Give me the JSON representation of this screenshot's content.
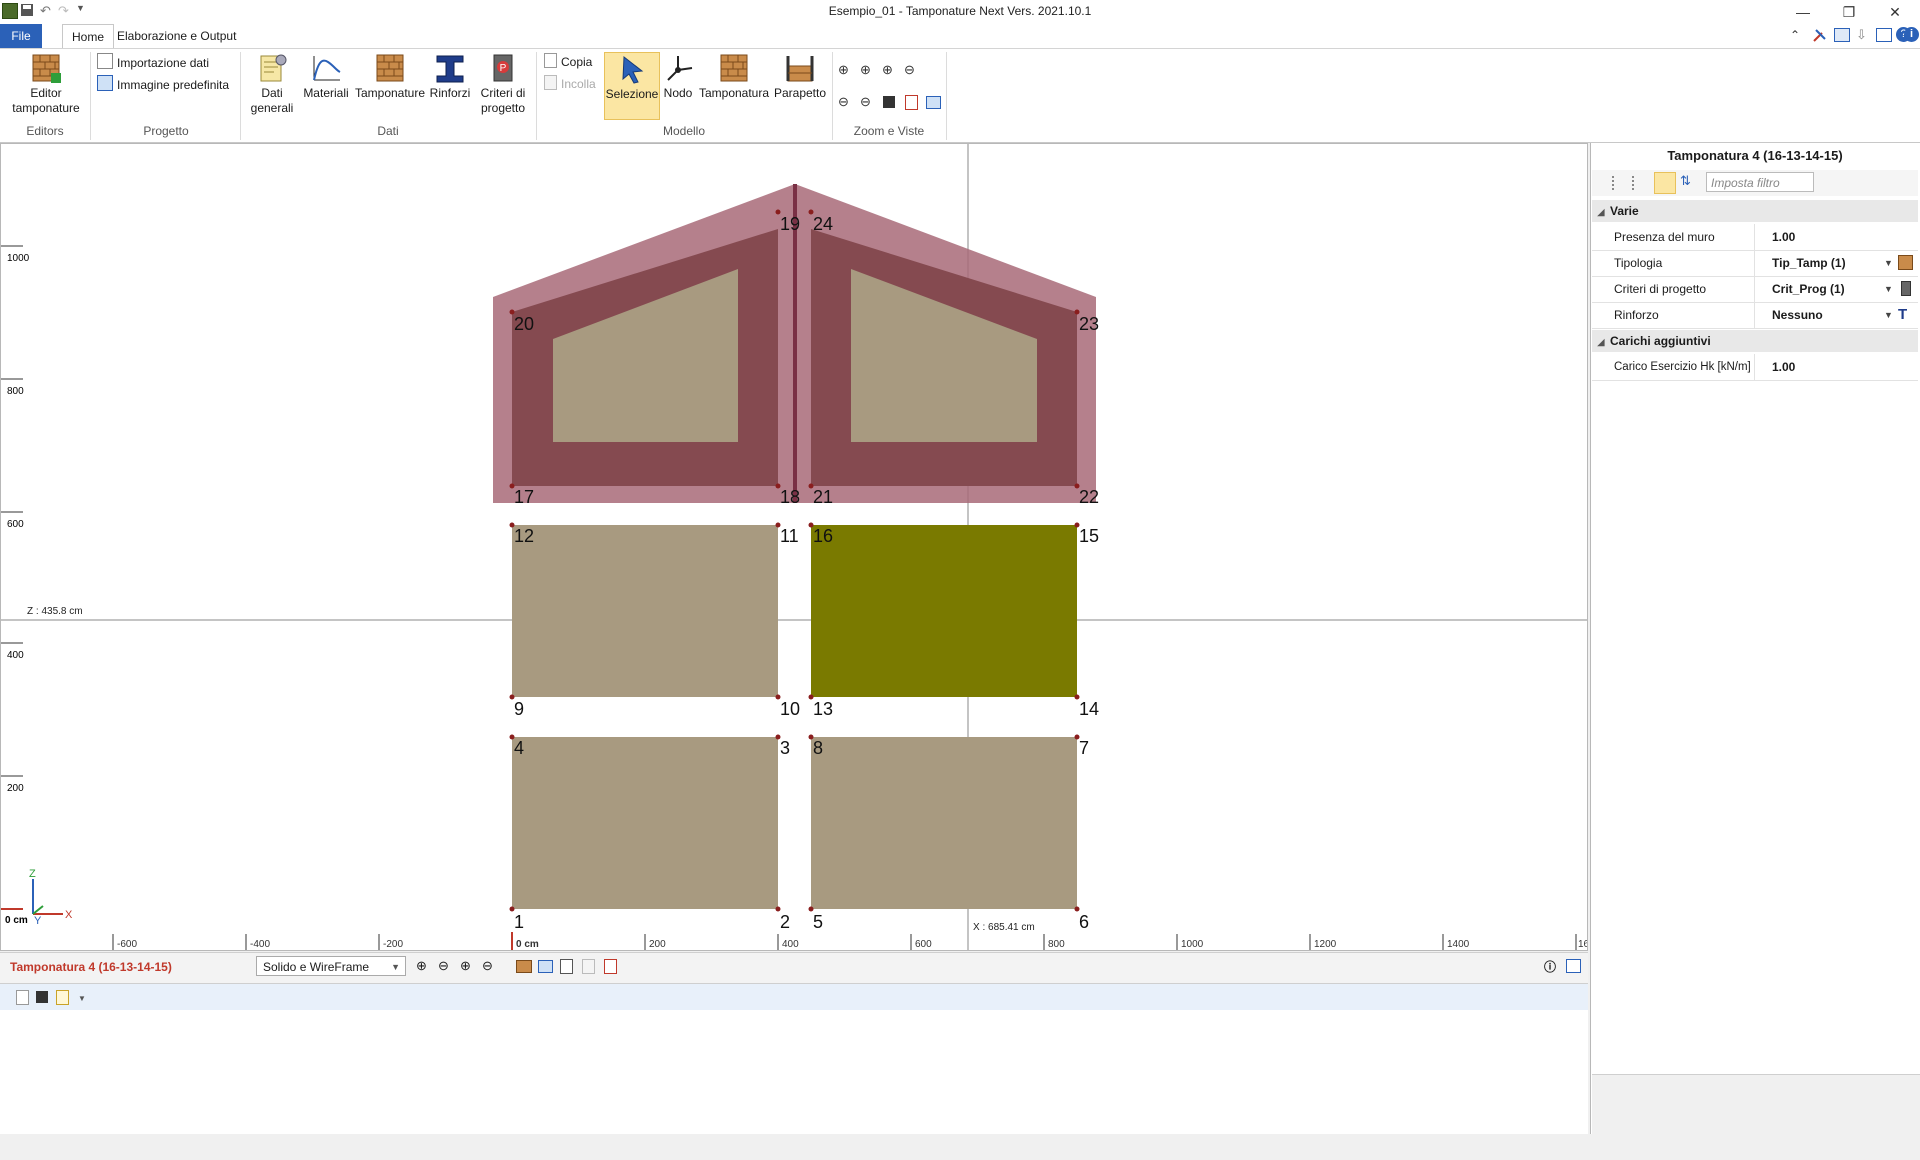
{
  "window": {
    "title": "Esempio_01 - Tamponature Next Vers. 2021.10.1",
    "minimize": "—",
    "restore": "❐",
    "close": "✕"
  },
  "tabs": {
    "file": "File",
    "home": "Home",
    "elab": "Elaborazione e Output"
  },
  "ribbon": {
    "editor": "Editor tamponature",
    "import": "Importazione dati",
    "image": "Immagine predefinita",
    "dati_generali": "Dati generali",
    "materiali": "Materiali",
    "tamponature": "Tamponature",
    "rinforzi": "Rinforzi",
    "criteri": "Criteri di progetto",
    "copia": "Copia",
    "incolla": "Incolla",
    "selezione": "Selezione",
    "nodo": "Nodo",
    "tamponatura": "Tamponatura",
    "parapetto": "Parapetto",
    "groups": {
      "editors": "Editors",
      "progetto": "Progetto",
      "dati": "Dati",
      "modello": "Modello",
      "zoom": "Zoom e Viste"
    }
  },
  "viewport": {
    "z_readout": "Z : 435.8 cm",
    "x_readout": "X : 685.41 cm",
    "y_ticks": [
      "1000",
      "800",
      "600",
      "400",
      "200"
    ],
    "y_origin": "0 cm",
    "x_ticks": [
      "-600",
      "-400",
      "-200",
      "0 cm",
      "200",
      "400",
      "600",
      "800",
      "1000",
      "1200",
      "1400",
      "16"
    ],
    "axis_z": "Z",
    "axis_x": "X",
    "axis_y": "Y",
    "nodes": [
      "1",
      "2",
      "3",
      "4",
      "5",
      "6",
      "7",
      "8",
      "9",
      "10",
      "11",
      "12",
      "13",
      "14",
      "15",
      "16",
      "17",
      "18",
      "19",
      "20",
      "21",
      "22",
      "23",
      "24"
    ]
  },
  "colors": {
    "wall": "#a89a80",
    "selected": "#7a7a00",
    "gable_outer": "#a86a78",
    "gable_inner": "#854a50",
    "accent": "#2b61b8"
  },
  "bottom": {
    "selection": "Tamponatura 4 (16-13-14-15)",
    "render_mode": "Solido e WireFrame"
  },
  "panel": {
    "title": "Tamponatura 4 (16-13-14-15)",
    "filter_placeholder": "Imposta filtro",
    "categories": [
      {
        "name": "Varie",
        "rows": [
          {
            "label": "Presenza del muro",
            "value": "1.00"
          },
          {
            "label": "Tipologia",
            "value": "Tip_Tamp (1)"
          },
          {
            "label": "Criteri di progetto",
            "value": "Crit_Prog (1)"
          },
          {
            "label": "Rinforzo",
            "value": "Nessuno"
          }
        ]
      },
      {
        "name": "Carichi aggiuntivi",
        "rows": [
          {
            "label": "Carico Esercizio Hk [kN/m]",
            "value": "1.00"
          }
        ]
      }
    ]
  }
}
